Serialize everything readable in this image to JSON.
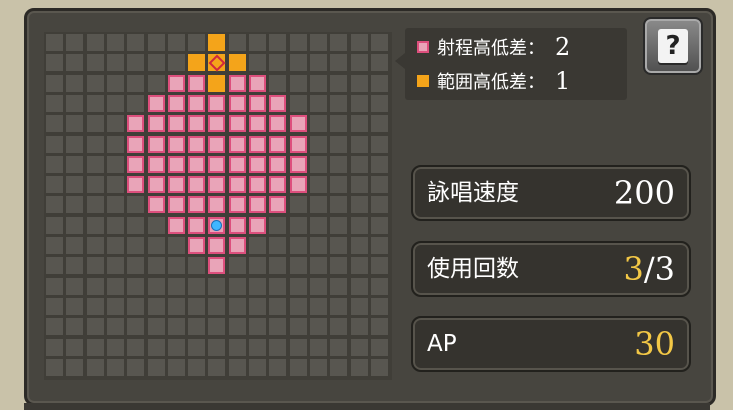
{
  "legend": {
    "range_label": "射程高低差：",
    "range_value": "2",
    "area_label": "範囲高低差：",
    "area_value": "1"
  },
  "help_button": {
    "label": "?",
    "icon": "help-book-icon"
  },
  "stats": {
    "cast_speed_label": "詠唱速度",
    "cast_speed_value": "200",
    "uses_label": "使用回数",
    "uses_current": "3",
    "uses_sep_total": "/3",
    "ap_label": "AP",
    "ap_value": "30"
  },
  "grid": {
    "columns": 17,
    "rows": 17,
    "center": [
      8,
      9
    ],
    "range_cells": [
      [
        6,
        2
      ],
      [
        7,
        2
      ],
      [
        8,
        2
      ],
      [
        9,
        2
      ],
      [
        10,
        2
      ],
      [
        5,
        3
      ],
      [
        6,
        3
      ],
      [
        7,
        3
      ],
      [
        8,
        3
      ],
      [
        9,
        3
      ],
      [
        10,
        3
      ],
      [
        11,
        3
      ],
      [
        4,
        4
      ],
      [
        5,
        4
      ],
      [
        6,
        4
      ],
      [
        7,
        4
      ],
      [
        8,
        4
      ],
      [
        9,
        4
      ],
      [
        10,
        4
      ],
      [
        11,
        4
      ],
      [
        12,
        4
      ],
      [
        4,
        5
      ],
      [
        5,
        5
      ],
      [
        6,
        5
      ],
      [
        7,
        5
      ],
      [
        8,
        5
      ],
      [
        9,
        5
      ],
      [
        10,
        5
      ],
      [
        11,
        5
      ],
      [
        12,
        5
      ],
      [
        5,
        6
      ],
      [
        6,
        6
      ],
      [
        7,
        6
      ],
      [
        8,
        6
      ],
      [
        9,
        6
      ],
      [
        10,
        6
      ],
      [
        11,
        6
      ],
      [
        6,
        7
      ],
      [
        7,
        7
      ],
      [
        8,
        7
      ],
      [
        9,
        7
      ],
      [
        10,
        7
      ],
      [
        7,
        8
      ],
      [
        8,
        8
      ],
      [
        9,
        8
      ],
      [
        8,
        9
      ]
    ],
    "colors": {
      "range_fill": "#e9a4b8",
      "range_border": "#dd4f7d",
      "area_fill": "#f4a41a",
      "empty": "#585650",
      "caster": "#40b6ff",
      "target": "#d0283c"
    }
  }
}
